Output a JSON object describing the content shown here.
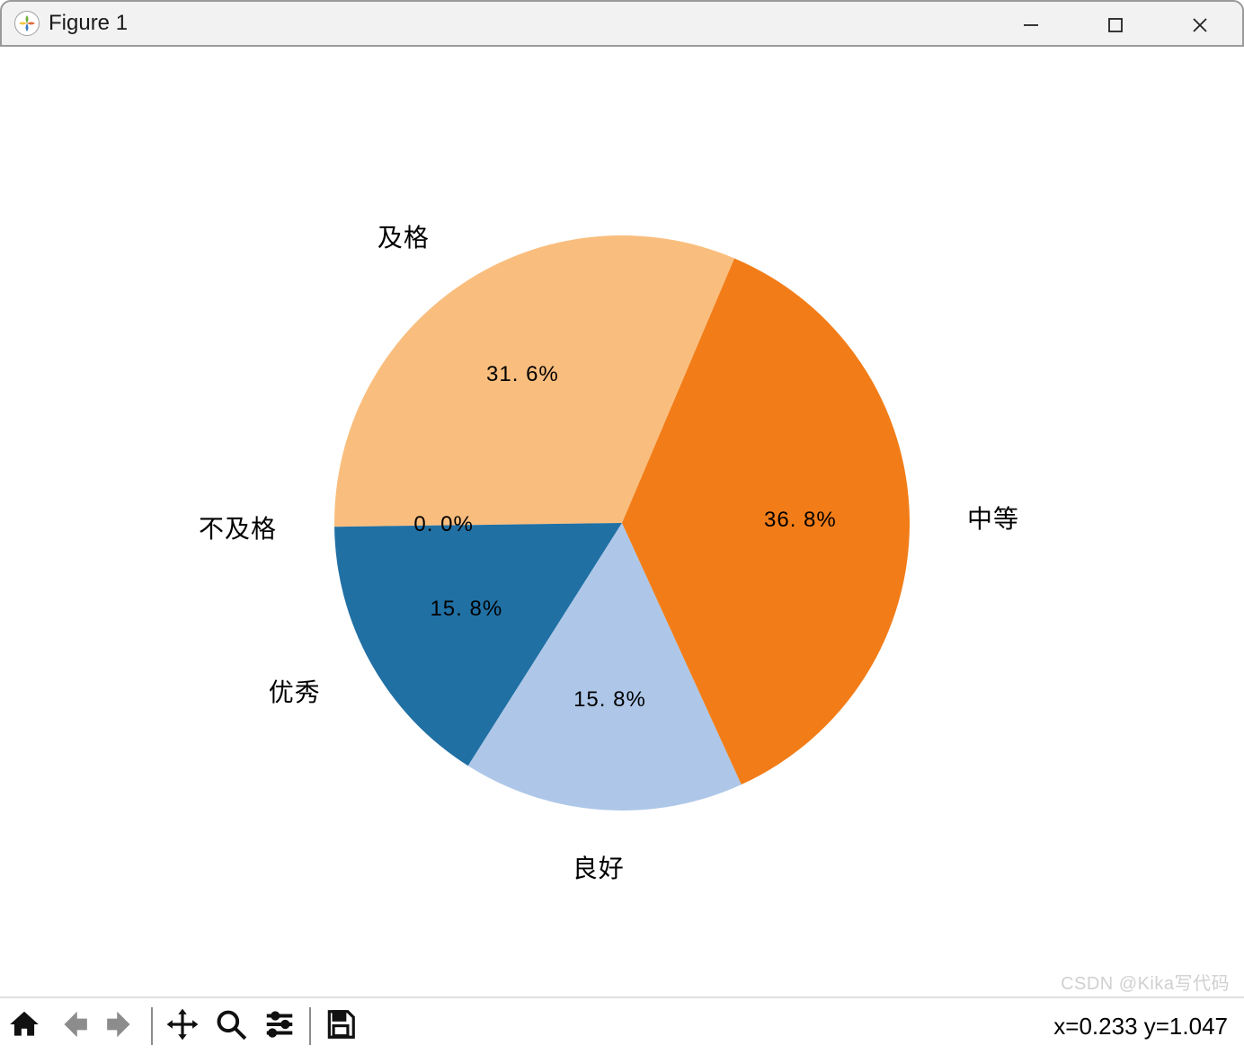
{
  "window": {
    "title": "Figure 1"
  },
  "toolbar": {
    "coords": "x=0.233 y=1.047"
  },
  "watermark": "CSDN @Kika写代码",
  "chart_data": {
    "type": "pie",
    "start_angle_deg": 67,
    "direction": "counterclockwise",
    "slices": [
      {
        "label": "及格",
        "value": 31.6,
        "pct_text": "31. 6%",
        "color": "#f9be7e"
      },
      {
        "label": "不及格",
        "value": 0.0,
        "pct_text": "0. 0%",
        "color": "#1f77b4"
      },
      {
        "label": "优秀",
        "value": 15.8,
        "pct_text": "15. 8%",
        "color": "#2070a4"
      },
      {
        "label": "良好",
        "value": 15.8,
        "pct_text": "15. 8%",
        "color": "#aec7e8"
      },
      {
        "label": "中等",
        "value": 36.8,
        "pct_text": "36. 8%",
        "color": "#f27d18"
      }
    ]
  }
}
